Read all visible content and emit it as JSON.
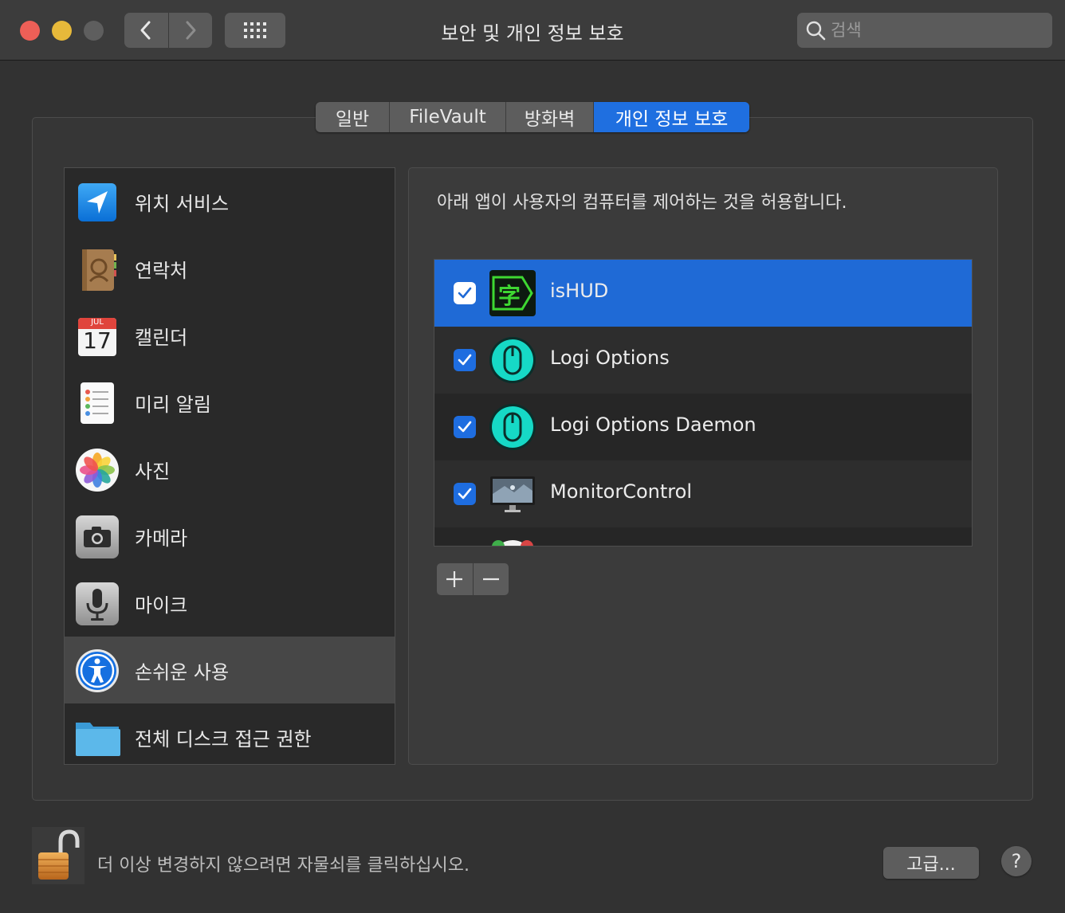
{
  "window": {
    "title": "보안 및 개인 정보 보호",
    "search_placeholder": "검색"
  },
  "tabs": [
    {
      "label": "일반",
      "active": false
    },
    {
      "label": "FileVault",
      "active": false
    },
    {
      "label": "방화벽",
      "active": false
    },
    {
      "label": "개인 정보 보호",
      "active": true
    }
  ],
  "sidebar": {
    "items": [
      {
        "label": "위치 서비스",
        "icon": "location-arrow-icon"
      },
      {
        "label": "연락처",
        "icon": "contacts-book-icon"
      },
      {
        "label": "캘린더",
        "icon": "calendar-icon",
        "month": "JUL",
        "day": "17"
      },
      {
        "label": "미리 알림",
        "icon": "reminders-icon"
      },
      {
        "label": "사진",
        "icon": "photos-flower-icon"
      },
      {
        "label": "카메라",
        "icon": "camera-icon"
      },
      {
        "label": "마이크",
        "icon": "microphone-icon"
      },
      {
        "label": "손쉬운 사용",
        "icon": "accessibility-icon",
        "selected": true
      },
      {
        "label": "전체 디스크 접근 권한",
        "icon": "folder-icon"
      }
    ]
  },
  "main": {
    "description": "아래 앱이 사용자의 컴퓨터를 제어하는 것을 허용합니다.",
    "apps": [
      {
        "label": "isHUD",
        "checked": true,
        "selected": true,
        "icon": "ishud-icon",
        "glyph": "字"
      },
      {
        "label": "Logi Options",
        "checked": true,
        "icon": "logi-mouse-icon"
      },
      {
        "label": "Logi Options Daemon",
        "checked": true,
        "icon": "logi-mouse-icon"
      },
      {
        "label": "MonitorControl",
        "checked": true,
        "icon": "monitor-icon"
      }
    ],
    "add_label": "+",
    "remove_label": "—"
  },
  "footer": {
    "lock_text": "더 이상 변경하지 않으려면 자물쇠를 클릭하십시오.",
    "advanced_label": "고급...",
    "help_label": "?"
  },
  "colors": {
    "accent": "#1f6fe0",
    "window_bg": "#323232",
    "titlebar_bg": "#3c3c3c"
  }
}
